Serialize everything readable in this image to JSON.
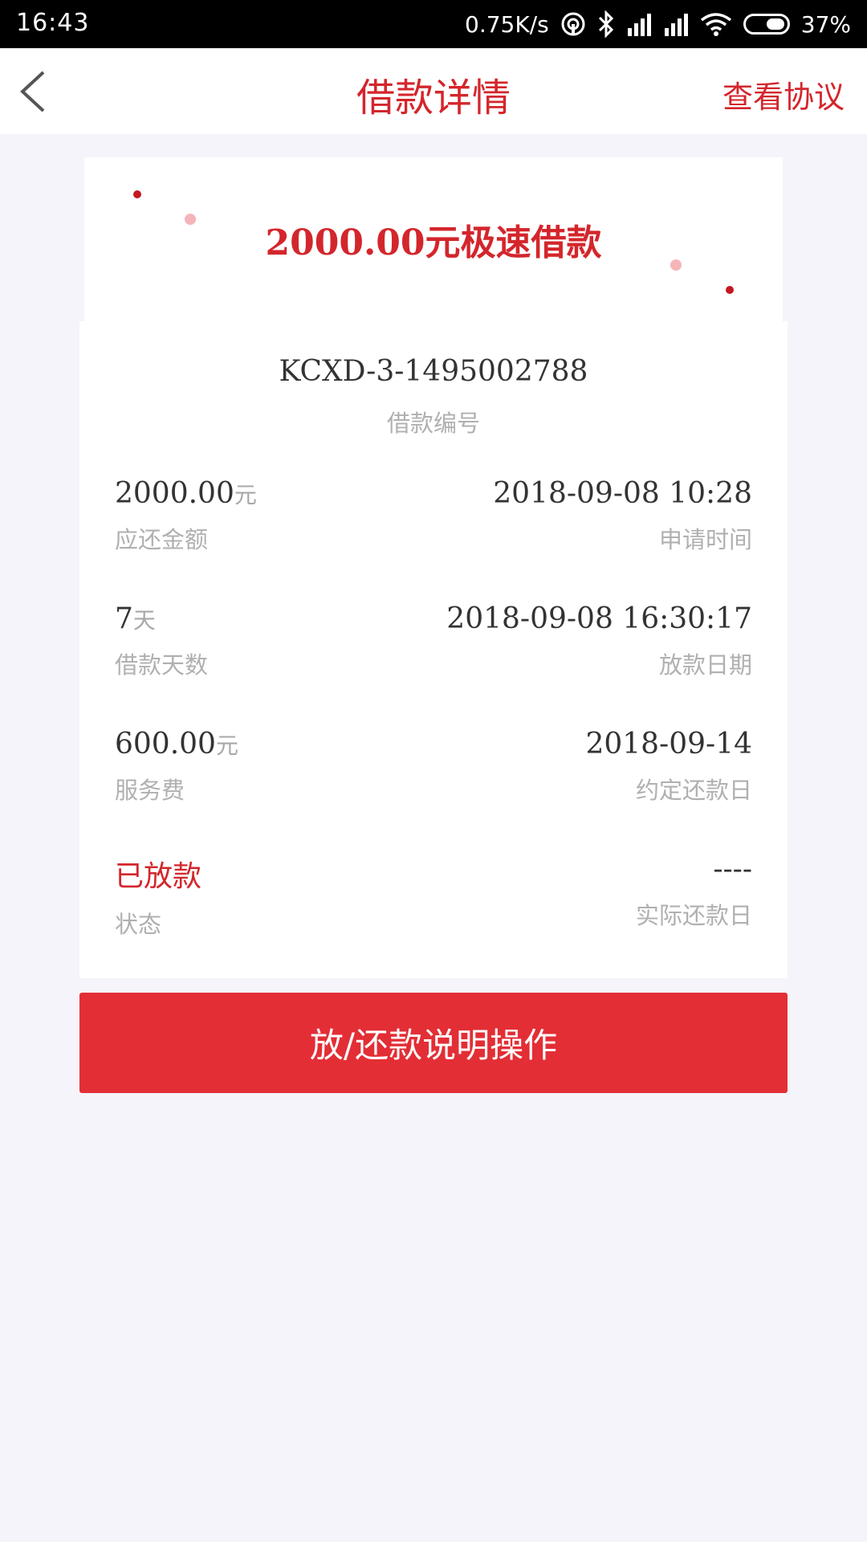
{
  "status_bar": {
    "time": "16:43",
    "speed": "0.75K/s",
    "battery": "37%",
    "icons": [
      "hotspot-icon",
      "bluetooth-icon",
      "signal-icon",
      "signal-icon",
      "wifi-icon",
      "battery-icon"
    ]
  },
  "header": {
    "title": "借款详情",
    "right_link": "查看协议",
    "accent": "#d3262c"
  },
  "banner": {
    "title": "2000.00元极速借款"
  },
  "loan": {
    "number": "KCXD-3-1495002788",
    "number_label": "借款编号"
  },
  "details": {
    "amount_due": {
      "value": "2000.00",
      "unit": "元",
      "label": "应还金额"
    },
    "apply_time": {
      "value": "2018-09-08 10:28",
      "label": "申请时间"
    },
    "loan_days": {
      "value": "7",
      "unit": "天",
      "label": "借款天数"
    },
    "disburse_date": {
      "value": "2018-09-08 16:30:17",
      "label": "放款日期"
    },
    "service_fee": {
      "value": "600.00",
      "unit": "元",
      "label": "服务费"
    },
    "due_date": {
      "value": "2018-09-14",
      "label": "约定还款日"
    },
    "status": {
      "value": "已放款",
      "label": "状态"
    },
    "actual_repay_date": {
      "value": "----",
      "label": "实际还款日"
    }
  },
  "action_button": {
    "label": "放/还款说明操作",
    "color": "#e32e35"
  }
}
